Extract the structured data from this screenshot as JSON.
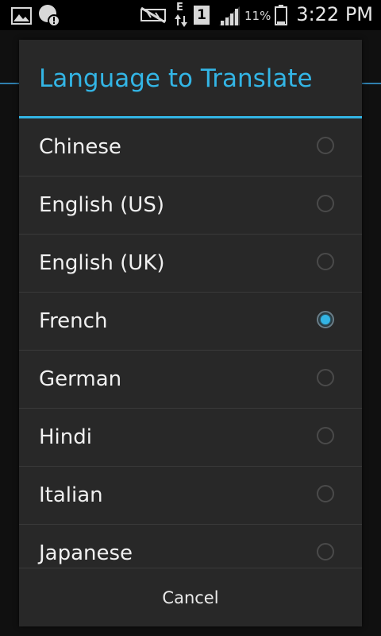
{
  "status_bar": {
    "time": "3:22 PM",
    "battery_percent": "11%",
    "sim_slot": "1",
    "network_type": "E",
    "icons": [
      "image-notification-icon",
      "alert-notification-icon",
      "mute-icon",
      "data-arrows-icon",
      "sim-icon",
      "signal-icon",
      "battery-icon"
    ]
  },
  "dialog": {
    "title": "Language to Translate",
    "options": [
      {
        "label": "Chinese",
        "checked": false
      },
      {
        "label": "English (US)",
        "checked": false
      },
      {
        "label": "English (UK)",
        "checked": false
      },
      {
        "label": "French",
        "checked": true
      },
      {
        "label": "German",
        "checked": false
      },
      {
        "label": "Hindi",
        "checked": false
      },
      {
        "label": "Italian",
        "checked": false
      },
      {
        "label": "Japanese",
        "checked": false
      }
    ],
    "cancel_label": "Cancel"
  },
  "colors": {
    "accent": "#33b5e5",
    "dialog_bg": "#282828",
    "text": "#f0f0f0"
  }
}
